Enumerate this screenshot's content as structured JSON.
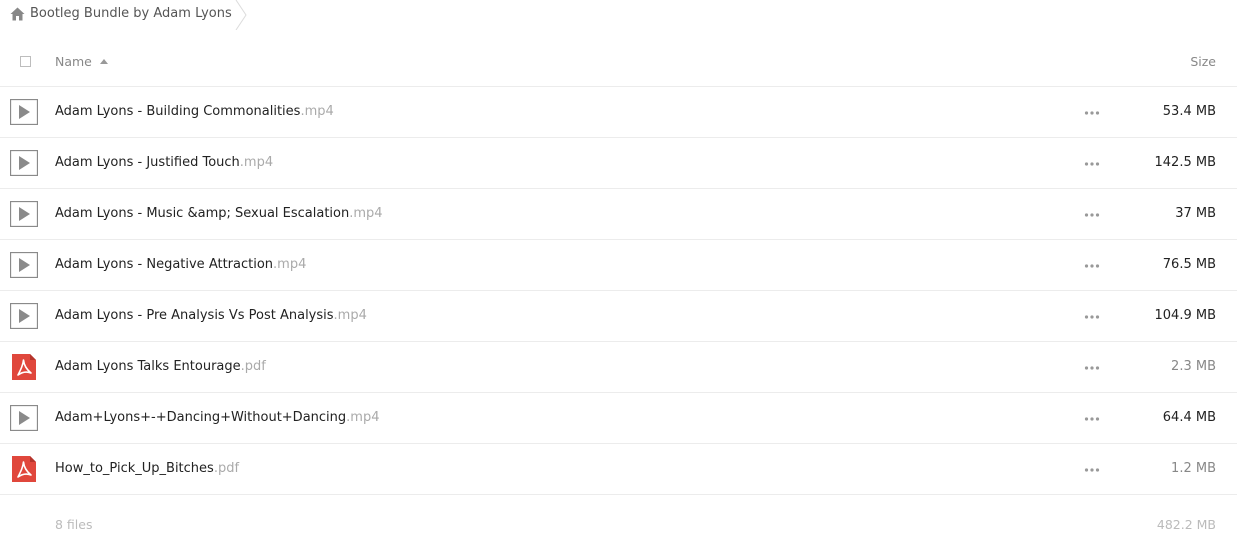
{
  "breadcrumb": {
    "folder_name": "Bootleg Bundle by Adam Lyons"
  },
  "columns": {
    "name": "Name",
    "size": "Size"
  },
  "files": [
    {
      "name": "Adam Lyons - Building Commonalities",
      "ext": ".mp4",
      "size": "53.4 MB",
      "type": "video"
    },
    {
      "name": "Adam Lyons - Justified Touch",
      "ext": ".mp4",
      "size": "142.5 MB",
      "type": "video"
    },
    {
      "name": "Adam Lyons - Music &amp; Sexual Escalation",
      "ext": ".mp4",
      "size": "37 MB",
      "type": "video"
    },
    {
      "name": "Adam Lyons - Negative Attraction",
      "ext": ".mp4",
      "size": "76.5 MB",
      "type": "video"
    },
    {
      "name": "Adam Lyons - Pre Analysis Vs Post Analysis",
      "ext": ".mp4",
      "size": "104.9 MB",
      "type": "video"
    },
    {
      "name": "Adam Lyons Talks Entourage",
      "ext": ".pdf",
      "size": "2.3 MB",
      "type": "pdf"
    },
    {
      "name": "Adam+Lyons+-+Dancing+Without+Dancing",
      "ext": ".mp4",
      "size": "64.4 MB",
      "type": "video"
    },
    {
      "name": "How_to_Pick_Up_Bitches",
      "ext": ".pdf",
      "size": "1.2 MB",
      "type": "pdf"
    }
  ],
  "footer": {
    "count": "8 files",
    "total": "482.2 MB"
  },
  "colors": {
    "pdf_red": "#e0473c",
    "video_gray": "#8a8a8a"
  }
}
